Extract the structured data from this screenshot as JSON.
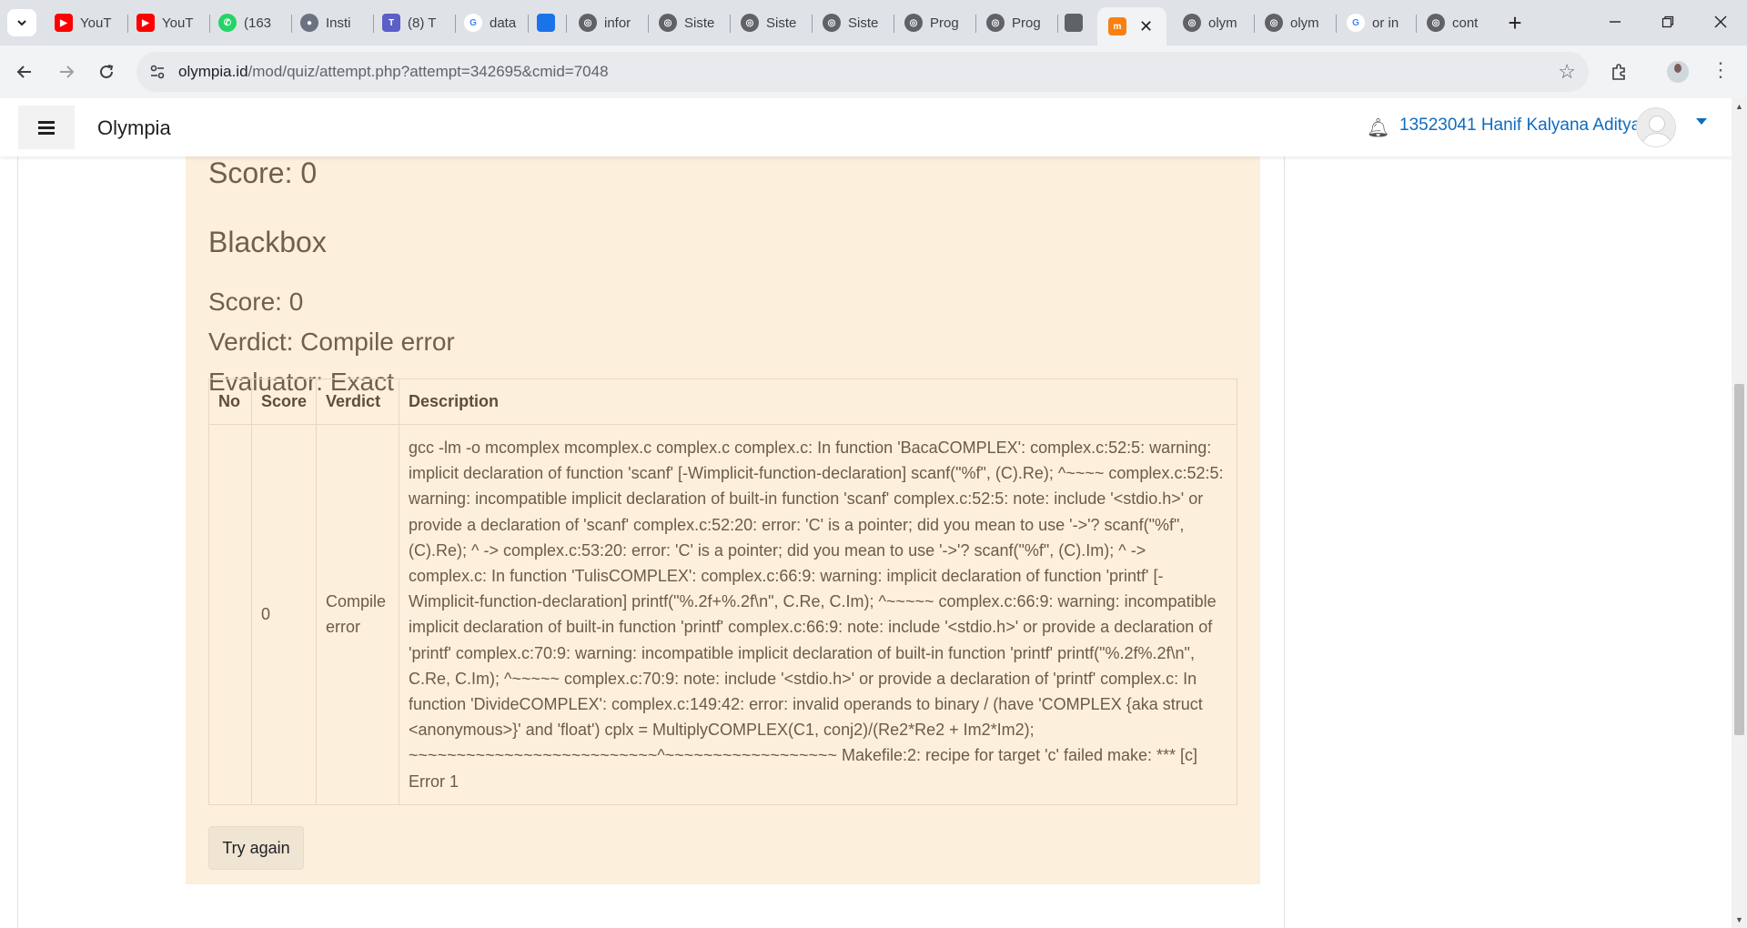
{
  "browser": {
    "tabs": [
      {
        "title": "YouT",
        "icon": "youtube-icon"
      },
      {
        "title": "YouT",
        "icon": "youtube-icon"
      },
      {
        "title": "(163",
        "icon": "whatsapp-icon"
      },
      {
        "title": "Insti",
        "icon": "instagram-icon"
      },
      {
        "title": "(8) T",
        "icon": "teams-icon"
      },
      {
        "title": "data",
        "icon": "google-icon"
      },
      {
        "title": "",
        "icon": "blue-square-icon"
      },
      {
        "title": "infor",
        "icon": "globe-icon"
      },
      {
        "title": "Siste",
        "icon": "globe-icon"
      },
      {
        "title": "Siste",
        "icon": "globe-icon"
      },
      {
        "title": "Siste",
        "icon": "globe-icon"
      },
      {
        "title": "Prog",
        "icon": "globe-icon"
      },
      {
        "title": "Prog",
        "icon": "globe-icon"
      },
      {
        "title": "",
        "icon": "gray-square-icon"
      },
      {
        "title": "",
        "icon": "moodle-icon"
      },
      {
        "title": "olym",
        "icon": "globe-icon"
      },
      {
        "title": "olym",
        "icon": "globe-icon"
      },
      {
        "title": "or in",
        "icon": "google-icon"
      },
      {
        "title": "cont",
        "icon": "globe-icon"
      }
    ],
    "url_host": "olympia.id",
    "url_path": "/mod/quiz/attempt.php?attempt=342695&cmid=7048"
  },
  "header": {
    "site_name": "Olympia",
    "user_name": "13523041 Hanif Kalyana Aditya"
  },
  "feedback": {
    "score_top": "Score: 0",
    "section_title": "Blackbox",
    "score": "Score: 0",
    "verdict": "Verdict: Compile error",
    "evaluator": "Evaluator: Exact",
    "table": {
      "headers": [
        "No",
        "Score",
        "Verdict",
        "Description"
      ],
      "rows": [
        {
          "no": "",
          "score": "0",
          "verdict": "Compile error",
          "description": "gcc -lm -o mcomplex mcomplex.c complex.c complex.c: In function 'BacaCOMPLEX': complex.c:52:5: warning: implicit declaration of function 'scanf' [-Wimplicit-function-declaration] scanf(\"%f\", (C).Re); ^~~~~ complex.c:52:5: warning: incompatible implicit declaration of built-in function 'scanf' complex.c:52:5: note: include '<stdio.h>' or provide a declaration of 'scanf' complex.c:52:20: error: 'C' is a pointer; did you mean to use '->'? scanf(\"%f\", (C).Re); ^ -> complex.c:53:20: error: 'C' is a pointer; did you mean to use '->'? scanf(\"%f\", (C).Im); ^ -> complex.c: In function 'TulisCOMPLEX': complex.c:66:9: warning: implicit declaration of function 'printf' [-Wimplicit-function-declaration] printf(\"%.2f+%.2f\\n\", C.Re, C.Im); ^~~~~~ complex.c:66:9: warning: incompatible implicit declaration of built-in function 'printf' complex.c:66:9: note: include '<stdio.h>' or provide a declaration of 'printf' complex.c:70:9: warning: incompatible implicit declaration of built-in function 'printf' printf(\"%.2f%.2f\\n\", C.Re, C.Im); ^~~~~~ complex.c:70:9: note: include '<stdio.h>' or provide a declaration of 'printf' complex.c: In function 'DivideCOMPLEX': complex.c:149:42: error: invalid operands to binary / (have 'COMPLEX {aka struct <anonymous>}' and 'float') cplx = MultiplyCOMPLEX(C1, conj2)/(Re2*Re2 + Im2*Im2); ~~~~~~~~~~~~~~~~~~~~~~~~~~^~~~~~~~~~~~~~~~~~~ Makefile:2: recipe for target 'c' failed make: *** [c] Error 1"
        }
      ]
    },
    "try_again_label": "Try again"
  },
  "colors": {
    "feedback_bg": "#fcefdc",
    "feedback_text": "#705f4b",
    "link_blue": "#0f6cbf"
  }
}
